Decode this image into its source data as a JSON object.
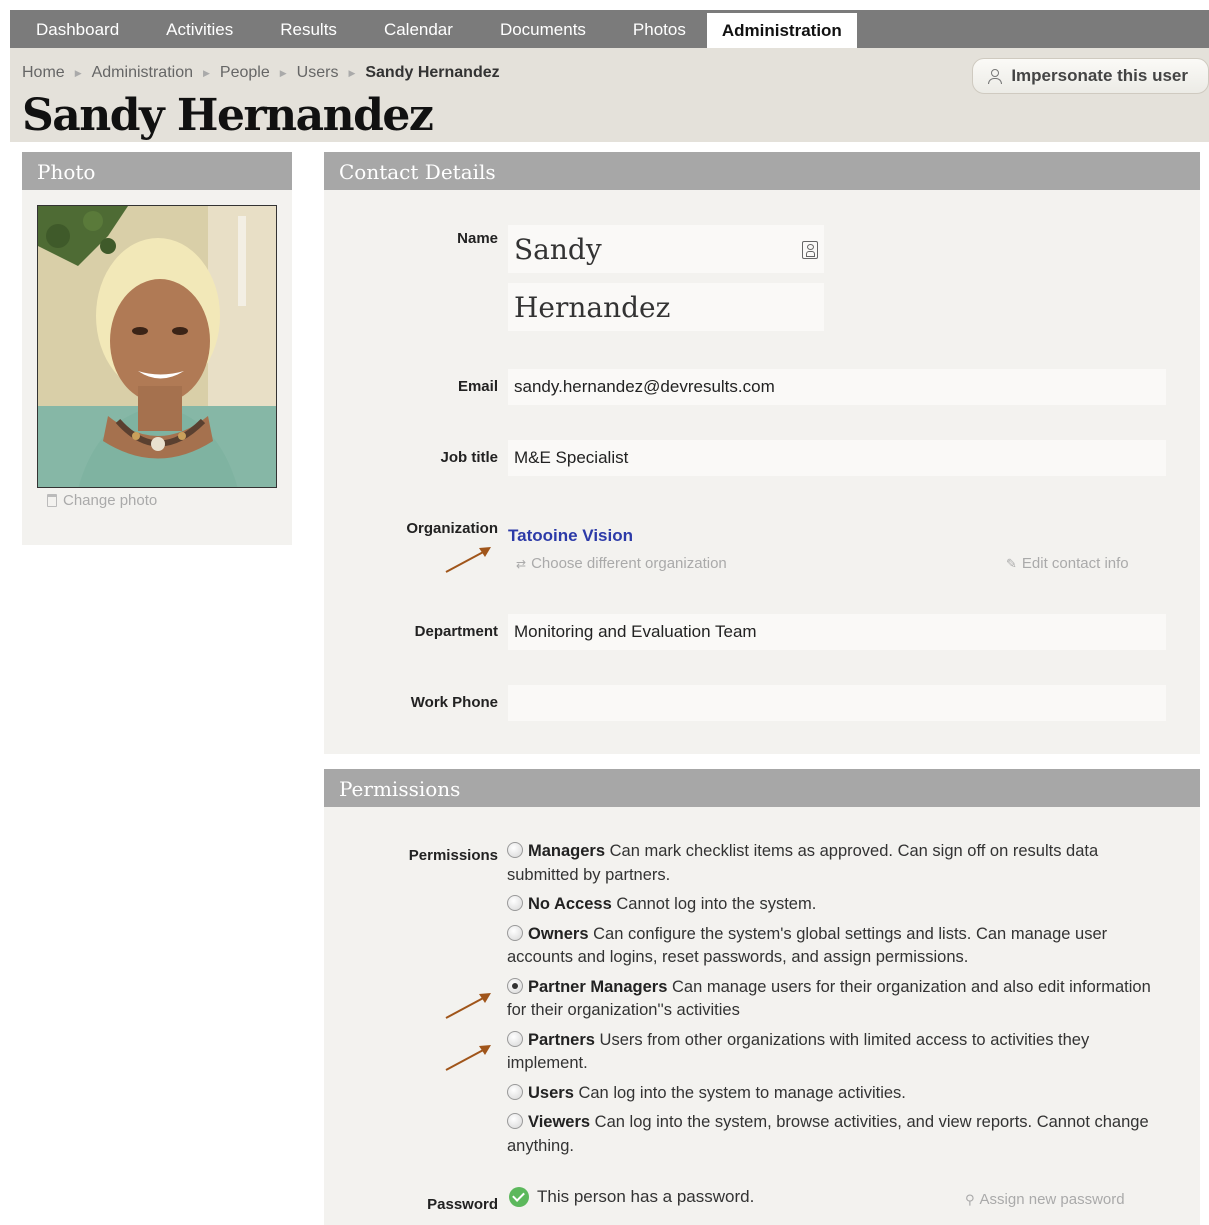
{
  "nav": {
    "tabs": [
      {
        "label": "Dashboard"
      },
      {
        "label": "Activities"
      },
      {
        "label": "Results"
      },
      {
        "label": "Calendar"
      },
      {
        "label": "Documents"
      },
      {
        "label": "Photos"
      },
      {
        "label": "Administration",
        "active": true
      }
    ]
  },
  "breadcrumb": [
    "Home",
    "Administration",
    "People",
    "Users",
    "Sandy Hernandez"
  ],
  "header": {
    "title": "Sandy Hernandez",
    "impersonate_label": "Impersonate this user"
  },
  "photo_panel": {
    "title": "Photo",
    "change_photo_label": "Change photo"
  },
  "contact": {
    "title": "Contact Details",
    "name_label": "Name",
    "first_name": "Sandy",
    "last_name": "Hernandez",
    "email_label": "Email",
    "email": "sandy.hernandez@devresults.com",
    "job_title_label": "Job title",
    "job_title": "M&E Specialist",
    "organization_label": "Organization",
    "organization": "Tatooine Vision",
    "choose_org_label": "Choose different organization",
    "edit_contact_label": "Edit contact info",
    "department_label": "Department",
    "department": "Monitoring and Evaluation Team",
    "work_phone_label": "Work Phone",
    "work_phone": ""
  },
  "permissions": {
    "title": "Permissions",
    "field_label": "Permissions",
    "options": [
      {
        "role": "Managers",
        "desc": "Can mark checklist items as approved. Can sign off on results data submitted by partners.",
        "selected": false
      },
      {
        "role": "No Access",
        "desc": "Cannot log into the system.",
        "selected": false
      },
      {
        "role": "Owners",
        "desc": "Can configure the system's global settings and lists. Can manage user accounts and logins, reset passwords, and assign permissions.",
        "selected": false
      },
      {
        "role": "Partner Managers",
        "desc": "Can manage users for their organization and also edit information for their organization''s activities",
        "selected": true
      },
      {
        "role": "Partners",
        "desc": "Users from other organizations with limited access to activities they implement.",
        "selected": false
      },
      {
        "role": "Users",
        "desc": "Can log into the system to manage activities.",
        "selected": false
      },
      {
        "role": "Viewers",
        "desc": "Can log into the system, browse activities, and view reports. Cannot change anything.",
        "selected": false
      }
    ],
    "password_label": "Password",
    "password_status": "This person has a password.",
    "assign_password_label": "Assign new password"
  },
  "colors": {
    "nav_bg": "#7b7b7b",
    "header_bg": "#e4e1da",
    "panel_head_bg": "#a7a7a7",
    "link": "#2c3aa8",
    "annotation_arrow": "#a0551a",
    "success": "#5cb85c"
  }
}
